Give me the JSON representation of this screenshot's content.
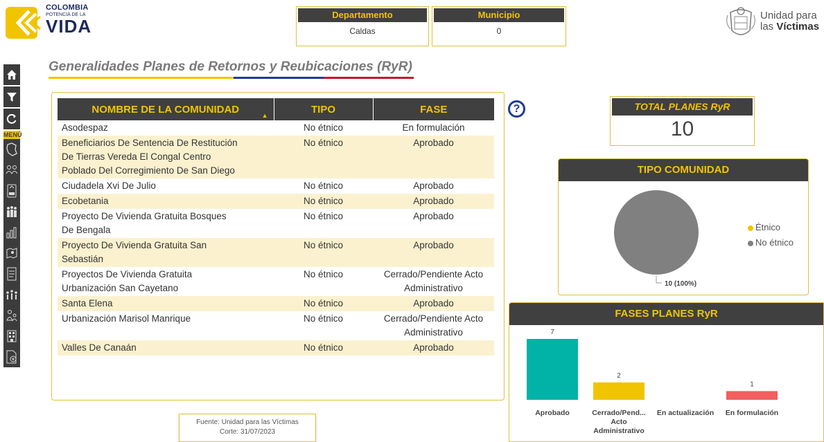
{
  "brand": {
    "line1": "COLOMBIA",
    "line2": "POTENCIA DE LA",
    "line3": "VIDA",
    "colors": {
      "yellow": "#f1c400",
      "dark": "#404040",
      "blue": "#1f3a93",
      "red": "#c8102e"
    }
  },
  "filters": [
    {
      "label": "Departamento",
      "value": "Caldas"
    },
    {
      "label": "Municipio",
      "value": "0"
    }
  ],
  "agency": {
    "line1": "Unidad para",
    "line2_prefix": "las ",
    "line2_bold": "Víctimas"
  },
  "nav": {
    "top_buttons": [
      "home-icon",
      "filter-icon",
      "reset-icon"
    ],
    "menu_label": "MENÚ",
    "menu_items": [
      "map-icon",
      "people-icon",
      "ruv-document-icon",
      "population-icon",
      "bar-chart-icon",
      "territory-map-icon",
      "report-icon",
      "community-icon",
      "family-icon",
      "building-icon",
      "add-document-icon"
    ]
  },
  "page_title": "Generalidades Planes de Retornos y Reubicaciones (RyR)",
  "table": {
    "columns": [
      "NOMBRE DE LA COMUNIDAD",
      "TIPO",
      "FASE"
    ],
    "rows": [
      {
        "nombre": [
          "Asodespaz"
        ],
        "tipo": "No étnico",
        "fase": [
          "En formulación"
        ]
      },
      {
        "nombre": [
          "Beneficiarios De Sentencia De Restitución",
          "De Tierras Vereda El Congal Centro",
          "Poblado Del Corregimiento De San Diego"
        ],
        "tipo": "No étnico",
        "fase": [
          "Aprobado"
        ]
      },
      {
        "nombre": [
          "Ciudadela Xvi De Julio"
        ],
        "tipo": "No étnico",
        "fase": [
          "Aprobado"
        ]
      },
      {
        "nombre": [
          "Ecobetania"
        ],
        "tipo": "No étnico",
        "fase": [
          "Aprobado"
        ]
      },
      {
        "nombre": [
          "Proyecto De Vivienda Gratuita Bosques",
          "De Bengala"
        ],
        "tipo": "No étnico",
        "fase": [
          "Aprobado"
        ]
      },
      {
        "nombre": [
          "Proyecto De Vivienda Gratuita San",
          "Sebastián"
        ],
        "tipo": "No étnico",
        "fase": [
          "Aprobado"
        ]
      },
      {
        "nombre": [
          "Proyectos De Vivienda Gratuita",
          "Urbanización San Cayetano"
        ],
        "tipo": "No étnico",
        "fase": [
          "Cerrado/Pendiente Acto",
          "Administrativo"
        ]
      },
      {
        "nombre": [
          "Santa Elena"
        ],
        "tipo": "No étnico",
        "fase": [
          "Aprobado"
        ]
      },
      {
        "nombre": [
          "Urbanización Marisol Manrique"
        ],
        "tipo": "No étnico",
        "fase": [
          "Cerrado/Pendiente Acto",
          "Administrativo"
        ]
      },
      {
        "nombre": [
          "Valles De Canaán"
        ],
        "tipo": "No étnico",
        "fase": [
          "Aprobado"
        ]
      }
    ]
  },
  "help_icon": "?",
  "kpi": {
    "title": "TOTAL PLANES RyR",
    "value": "10"
  },
  "chart_data": [
    {
      "type": "pie",
      "title": "TIPO COMUNIDAD",
      "categories": [
        "Étnico",
        "No étnico"
      ],
      "values": [
        0,
        10
      ],
      "colors": [
        "#f1c400",
        "#808080"
      ],
      "data_labels": [
        "10 (100%)"
      ],
      "legend": "right"
    },
    {
      "type": "bar",
      "title": "FASES PLANES RyR",
      "categories": [
        [
          "Aprobado"
        ],
        [
          "Cerrado/Pend...",
          "Acto",
          "Administrativo"
        ],
        [
          "En actualización"
        ],
        [
          "En formulación"
        ]
      ],
      "values": [
        7,
        2,
        0,
        1
      ],
      "value_labels": [
        "7",
        "2",
        "",
        "1"
      ],
      "colors": [
        "#00b3a6",
        "#f1c400",
        "#00b3a6",
        "#f35e5e"
      ],
      "ylim": [
        0,
        7
      ]
    }
  ],
  "source": {
    "line1": "Fuente: Unidad para las Víctimas",
    "line2": "Corte: 31/07/2023"
  }
}
